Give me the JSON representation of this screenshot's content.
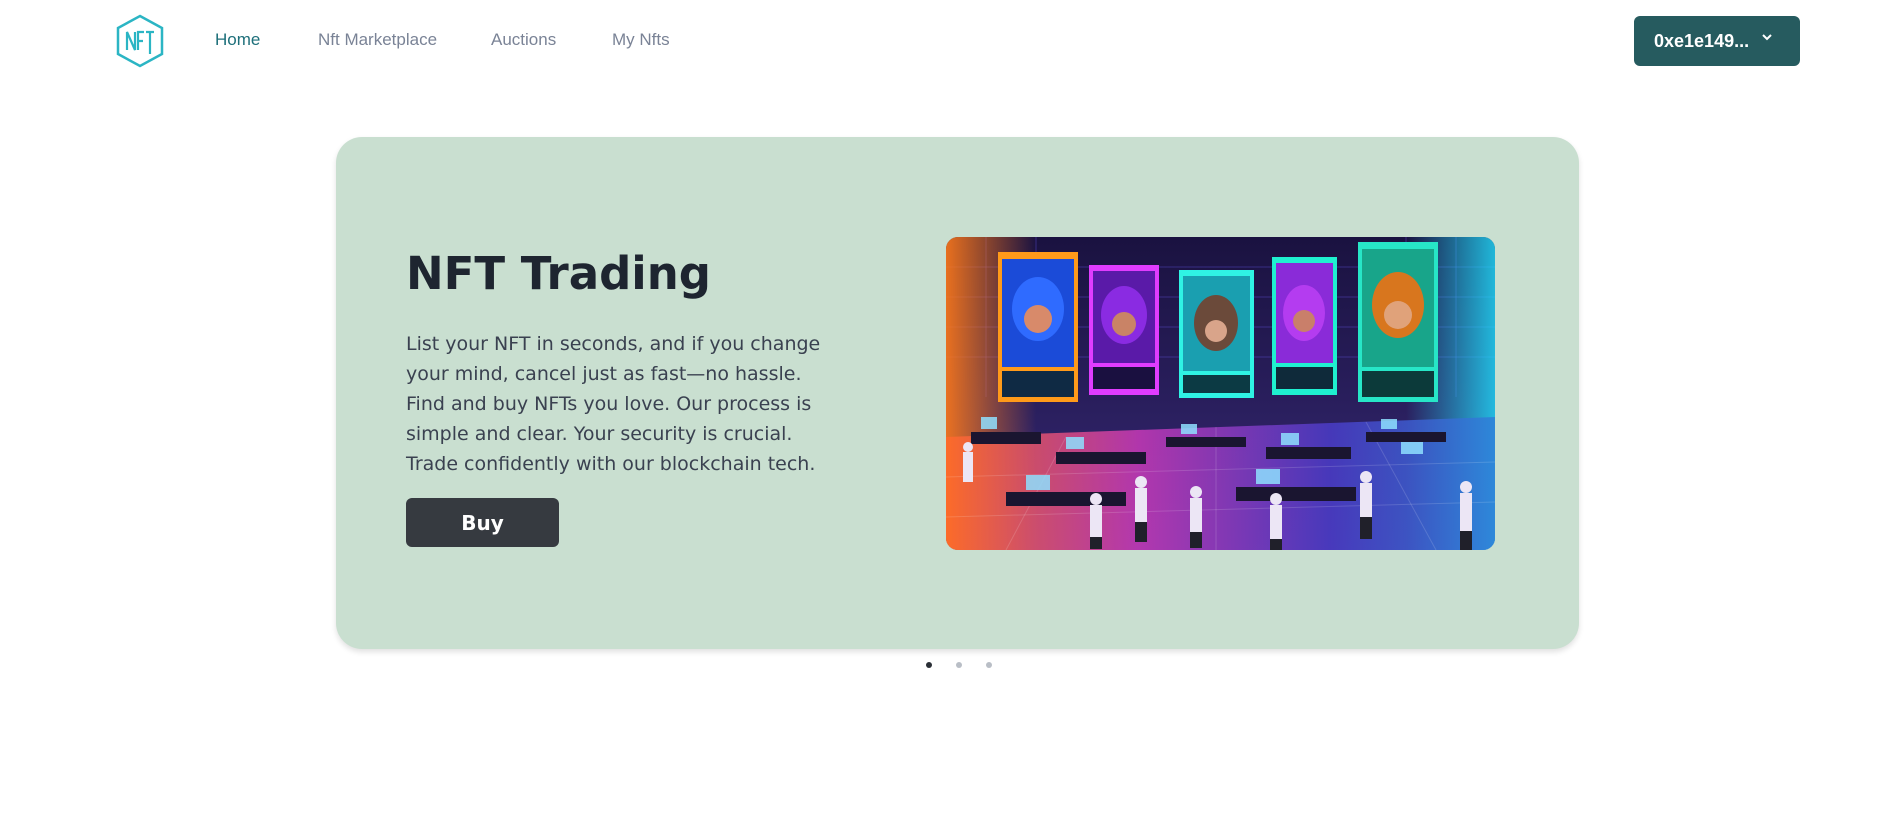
{
  "nav": {
    "links": [
      {
        "label": "Home",
        "active": true
      },
      {
        "label": "Nft Marketplace",
        "active": false
      },
      {
        "label": "Auctions",
        "active": false
      },
      {
        "label": "My Nfts",
        "active": false
      }
    ],
    "wallet": {
      "label": "0xe1e149...",
      "icon": "chevron-down-icon"
    },
    "logo": {
      "text": "NFT",
      "color": "#2bb5c4"
    }
  },
  "hero": {
    "title": "NFT Trading",
    "description": "List your NFT in seconds, and if you change your mind, cancel just as fast—no hassle. Find and buy NFTs you love. Our process is simple and clear. Your security is crucial. Trade confidently with our blockchain tech.",
    "buy_label": "Buy",
    "background": "#c9dfd0",
    "image": {
      "name": "nft-trading-illustration"
    }
  },
  "carousel": {
    "count": 3,
    "active_index": 0
  },
  "colors": {
    "accent": "#265b5f",
    "active_link": "#1d6f7a",
    "muted_link": "#7a8396",
    "button_dark": "#363a40"
  }
}
